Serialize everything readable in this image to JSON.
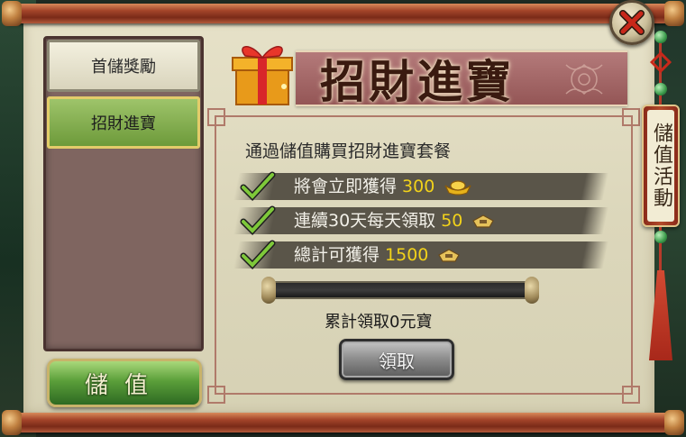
{
  "tabs": [
    {
      "label": "首儲獎勵",
      "active": false
    },
    {
      "label": "招財進寶",
      "active": true
    }
  ],
  "recharge_button": "儲值",
  "banner": {
    "title": "招財進寶"
  },
  "content": {
    "intro": "通過儲值購買招財進寶套餐",
    "rows": [
      {
        "text": "將會立即獲得",
        "amount": "300",
        "icon": "gold-ingot-icon"
      },
      {
        "text": "連續30天每天領取",
        "amount": "50",
        "icon": "gold-ingot-icon"
      },
      {
        "text": "總計可獲得",
        "amount": "1500",
        "icon": "gold-ingot-icon"
      }
    ],
    "progress": 0,
    "claimed_text": "累計領取0元寶",
    "claim_button": "領取"
  },
  "side_tag": "儲值活動",
  "colors": {
    "parchment": "#dcd7bb",
    "amount": "#f2d21a",
    "banner": "#a46666",
    "active_tab": "#8ab455"
  }
}
